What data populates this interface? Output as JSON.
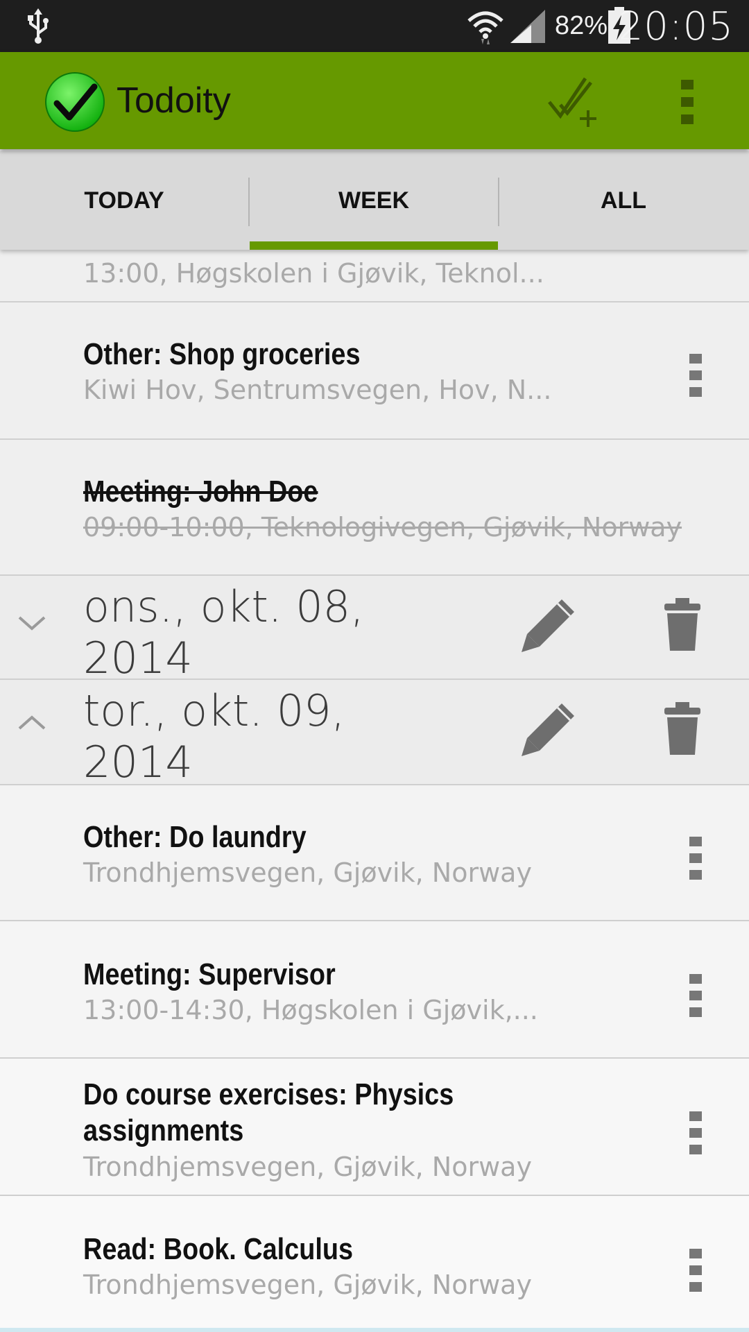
{
  "status_bar": {
    "battery": "82%",
    "time": "20:05"
  },
  "app": {
    "title": "Todoity"
  },
  "tabs": [
    "TODAY",
    "WEEK",
    "ALL"
  ],
  "selected_tab": "WEEK",
  "colors": {
    "accent": "#669900",
    "status_bar": "#1e1e1e"
  },
  "list": {
    "partial_row": {
      "subtitle": "13:00, Høgskolen i Gjøvik, Teknol..."
    },
    "items_before": [
      {
        "title": "Other: Shop groceries",
        "subtitle": "Kiwi Hov, Sentrumsvegen, Hov, N..."
      },
      {
        "title": "Meeting: John Doe",
        "subtitle": "09:00-10:00, Teknologivegen, Gjøvik, Norway",
        "completed": true
      }
    ],
    "date_groups": [
      {
        "date_line1": "ons., okt. 08,",
        "date_line2": "2014",
        "expanded": false
      },
      {
        "date_line1": "tor., okt. 09,",
        "date_line2": "2014",
        "expanded": true
      }
    ],
    "items_after": [
      {
        "title": "Other: Do laundry",
        "subtitle": "Trondhjemsvegen, Gjøvik, Norway"
      },
      {
        "title": "Meeting: Supervisor",
        "subtitle": "13:00-14:30, Høgskolen i Gjøvik,..."
      },
      {
        "title": "Do course exercises: Physics assignments",
        "subtitle": "Trondhjemsvegen, Gjøvik, Norway"
      },
      {
        "title": "Read: Book. Calculus",
        "subtitle": "Trondhjemsvegen, Gjøvik, Norway"
      }
    ]
  }
}
